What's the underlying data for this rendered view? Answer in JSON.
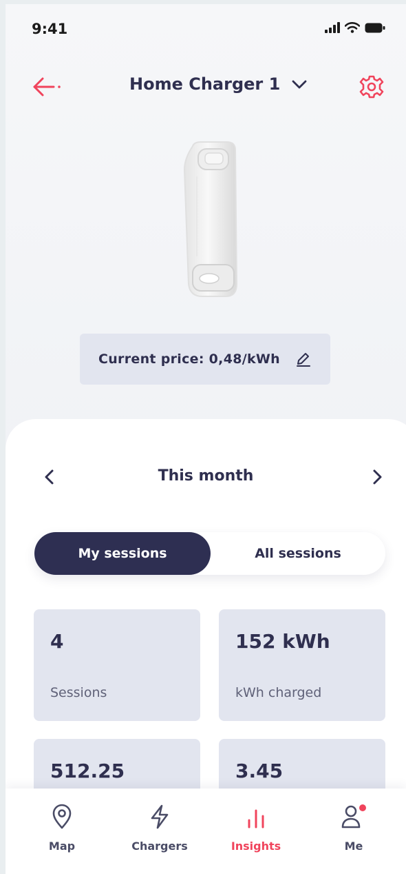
{
  "status_bar": {
    "time": "9:41",
    "icons": [
      "signal-icon",
      "wifi-icon",
      "battery-icon"
    ]
  },
  "header": {
    "title": "Home Charger 1",
    "back_icon": "arrow-left-icon",
    "dropdown_icon": "chevron-down-icon",
    "settings_icon": "gear-icon"
  },
  "price": {
    "label": "Current price: 0,48/kWh",
    "edit_icon": "pencil-icon"
  },
  "period": {
    "label": "This month"
  },
  "segments": {
    "active": "My sessions",
    "inactive": "All sessions"
  },
  "stats": [
    {
      "value": "4",
      "label": "Sessions"
    },
    {
      "value": "152 kWh",
      "label": "kWh charged"
    },
    {
      "value": "512.25",
      "label": ""
    },
    {
      "value": "3.45",
      "label": ""
    }
  ],
  "nav": [
    {
      "label": "Map",
      "icon": "map-pin-icon",
      "active": false
    },
    {
      "label": "Chargers",
      "icon": "lightning-icon",
      "active": false
    },
    {
      "label": "Insights",
      "icon": "bar-chart-icon",
      "active": true
    },
    {
      "label": "Me",
      "icon": "user-icon",
      "active": false,
      "badge": true
    }
  ],
  "colors": {
    "accent": "#f0445c",
    "navy": "#2e2f52",
    "card": "#e2e5ef",
    "text": "#2f2f4f"
  }
}
